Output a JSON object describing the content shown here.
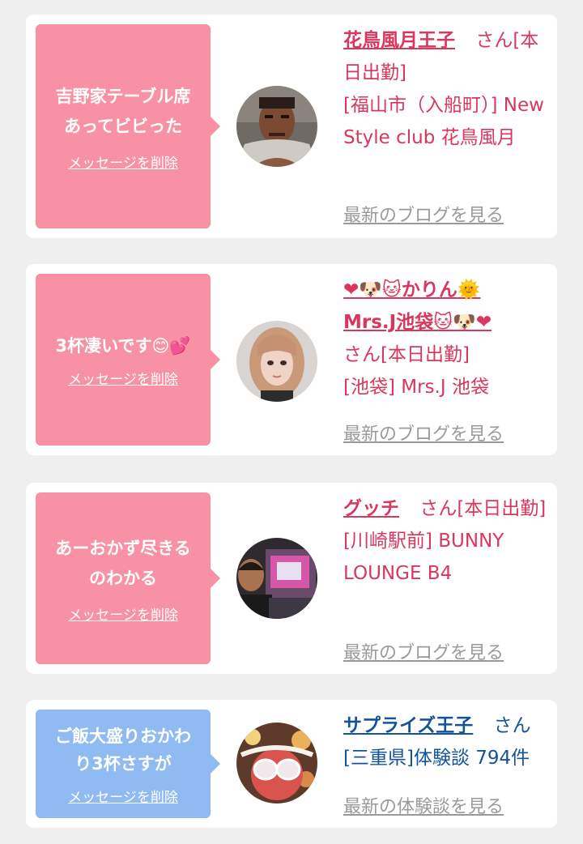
{
  "items": [
    {
      "message": "吉野家テーブル席あってビビった",
      "message_lines": [
        "吉野家テーブル席",
        "あってビビった"
      ],
      "delete_label": "メッセージを削除",
      "user_name": "花鳥風月王子",
      "honorific": "さん",
      "status": "[本日出勤]",
      "location": "[福山市（入船町）]",
      "shop": "New Style club 花鳥風月",
      "link_label": "最新のブログを見る",
      "bubble_color": "#f891a3",
      "text_color": "#d9375e"
    },
    {
      "message": "3杯凄いです",
      "message_emoji": "😊💕",
      "delete_label": "メッセージを削除",
      "name_emoji_before": "❤🐶🐱",
      "user_name": "かりん",
      "name_emoji_mid": "🌞",
      "user_name_2": "Mrs.J池袋",
      "name_emoji_after": "🐱🐶❤",
      "honorific": "さん",
      "status": "[本日出勤]",
      "location": "[池袋]",
      "shop": "Mrs.J 池袋",
      "link_label": "最新のブログを見る",
      "bubble_color": "#f891a3",
      "text_color": "#d9375e"
    },
    {
      "message": "あーおかず尽きるのわかる",
      "message_lines": [
        "あーおかず尽きる",
        "のわかる"
      ],
      "delete_label": "メッセージを削除",
      "user_name": "グッチ",
      "honorific": "さん",
      "status": "[本日出勤]",
      "location": "[川崎駅前]",
      "shop": "BUNNY LOUNGE B4",
      "link_label": "最新のブログを見る",
      "bubble_color": "#f891a3",
      "text_color": "#d9375e"
    },
    {
      "message": "ご飯大盛りおかわり3杯さすが",
      "message_lines": [
        "ご飯大盛りおかわ",
        "り3杯さすが"
      ],
      "delete_label": "メッセージを削除",
      "user_name": "サプライズ王子",
      "honorific": "さん",
      "location": "[三重県]",
      "review_label": "体験談",
      "review_count": "794件",
      "link_label": "最新の体験談を見る",
      "bubble_color": "#8fbaf2",
      "text_color": "#14539a"
    }
  ]
}
